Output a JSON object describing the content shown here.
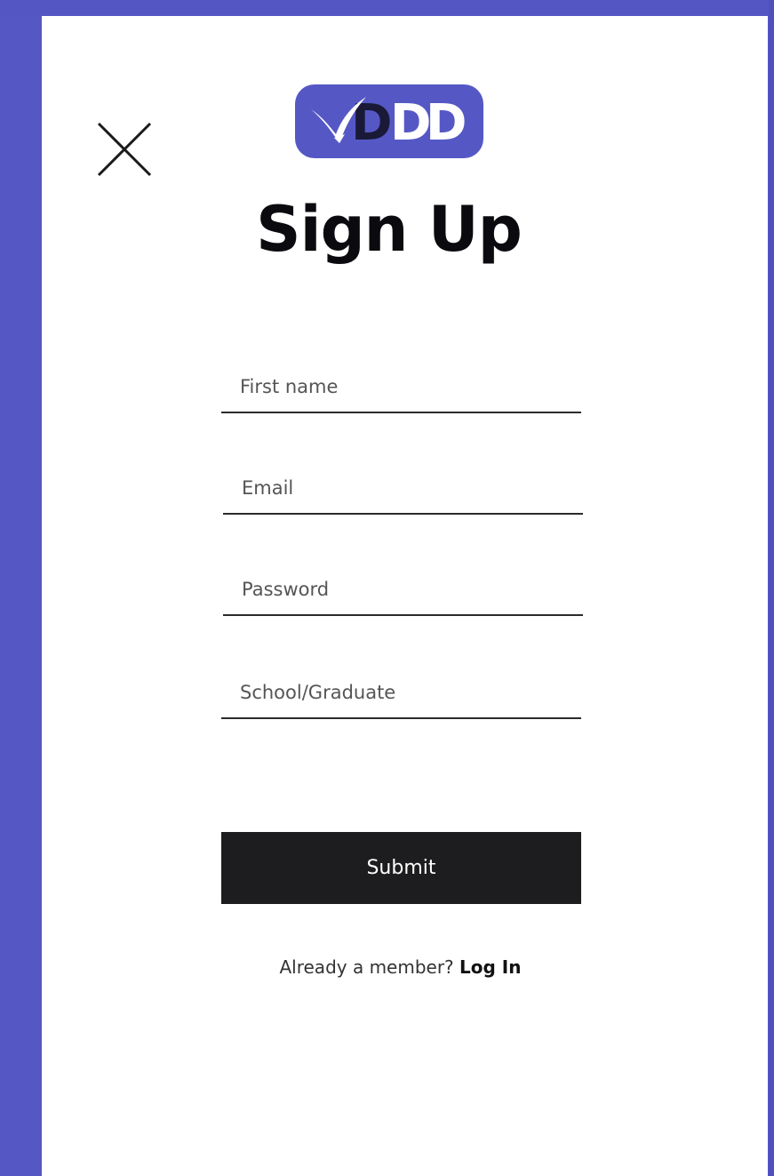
{
  "colors": {
    "background": "#5558c4",
    "panel": "#ffffff",
    "logo_bg": "#5558c4",
    "button_bg": "#1d1d1f",
    "button_text": "#ffffff"
  },
  "close_button": {
    "icon": "close-icon"
  },
  "logo": {
    "icon": "bird-logo-icon",
    "text": "DDD"
  },
  "form": {
    "title": "Sign Up",
    "fields": {
      "first_name": {
        "placeholder": "First name",
        "value": ""
      },
      "email": {
        "placeholder": "Email",
        "value": ""
      },
      "password": {
        "placeholder": "Password",
        "value": ""
      },
      "school": {
        "placeholder": "School/Graduate",
        "value": ""
      }
    },
    "submit_label": "Submit"
  },
  "footer": {
    "member_text": "Already a member?",
    "login_label": "Log In"
  }
}
